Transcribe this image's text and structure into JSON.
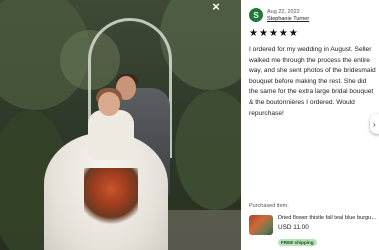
{
  "modal": {
    "close_label": "×"
  },
  "review": {
    "avatar_letter": "S",
    "date": "Aug 22, 2022",
    "reviewer": "Stephanie Turner",
    "rating": 5,
    "star_glyph": "★",
    "text": "I ordered for my wedding in August. Seller walked me through the process the entire way, and she sent photos of the bridesmaid bouquet before making the rest. She did the same for the extra large bridal bouquet & the boutonnières I ordered. Would repurchase!"
  },
  "nav": {
    "next_glyph": "›"
  },
  "purchased": {
    "label": "Purchased item:",
    "item_title": "Dried flower thistle fall teal blue burgundy",
    "price": "USD 11.00",
    "badge": "FREE shipping"
  },
  "colors": {
    "avatar_bg": "#1f7a3a",
    "badge_bg": "#b7e4b9"
  }
}
